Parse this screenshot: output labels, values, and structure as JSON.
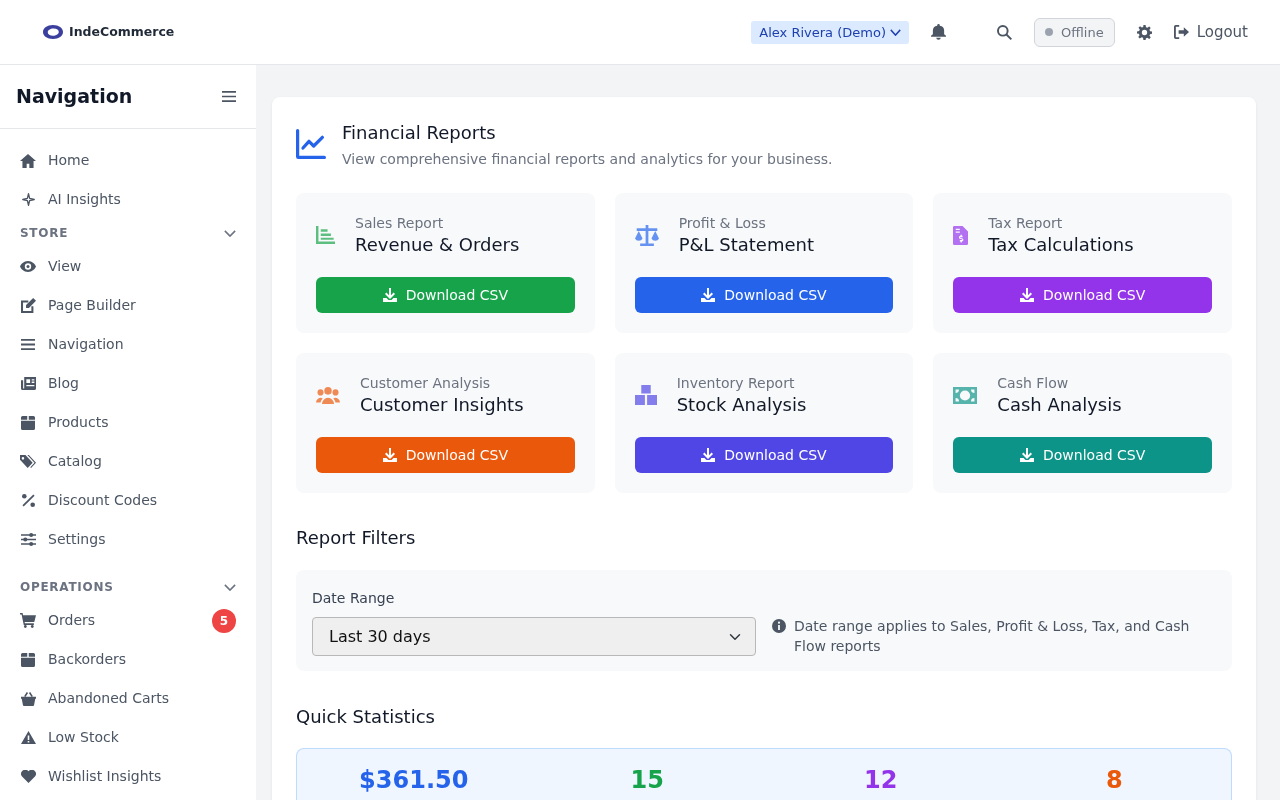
{
  "header": {
    "brand": "IndeCommerce",
    "user_menu": "Alex Rivera (Demo)",
    "status": {
      "label": "Offline",
      "online": false
    },
    "logout": "Logout"
  },
  "sidebar": {
    "title": "Navigation",
    "items": [
      {
        "label": "Home",
        "selected": false
      },
      {
        "label": "AI Insights",
        "selected": false
      }
    ],
    "sections": [
      {
        "heading": "STORE",
        "expanded": true,
        "items": [
          {
            "label": "View",
            "selected": false
          },
          {
            "label": "Page Builder",
            "selected": false
          },
          {
            "label": "Navigation",
            "selected": false
          },
          {
            "label": "Blog",
            "selected": false
          },
          {
            "label": "Products",
            "selected": false
          },
          {
            "label": "Catalog",
            "selected": false
          },
          {
            "label": "Discount Codes",
            "selected": false
          },
          {
            "label": "Settings",
            "selected": false
          }
        ]
      },
      {
        "heading": "OPERATIONS",
        "expanded": true,
        "items": [
          {
            "label": "Orders",
            "selected": false,
            "badge": "5"
          },
          {
            "label": "Backorders",
            "selected": false
          },
          {
            "label": "Abandoned Carts",
            "selected": false
          },
          {
            "label": "Low Stock",
            "selected": false
          },
          {
            "label": "Wishlist Insights",
            "selected": false
          }
        ]
      }
    ]
  },
  "main": {
    "title": "Financial Reports",
    "subtitle": "View comprehensive financial reports and analytics for your business.",
    "reports": [
      {
        "label": "Sales Report",
        "title": "Revenue & Orders",
        "button": "Download CSV",
        "color": "#16a34a"
      },
      {
        "label": "Profit & Loss",
        "title": "P&L Statement",
        "button": "Download CSV",
        "color": "#2563eb"
      },
      {
        "label": "Tax Report",
        "title": "Tax Calculations",
        "button": "Download CSV",
        "color": "#9333ea"
      },
      {
        "label": "Customer Analysis",
        "title": "Customer Insights",
        "button": "Download CSV",
        "color": "#ea580c"
      },
      {
        "label": "Inventory Report",
        "title": "Stock Analysis",
        "button": "Download CSV",
        "color": "#4f46e5"
      },
      {
        "label": "Cash Flow",
        "title": "Cash Analysis",
        "button": "Download CSV",
        "color": "#0d9488"
      }
    ],
    "filters": {
      "heading": "Report Filters",
      "date_range": {
        "label": "Date Range",
        "value": "Last 30 days"
      },
      "note": "Date range applies to Sales, Profit & Loss, Tax, and Cash Flow reports"
    },
    "quick_stats": {
      "heading": "Quick Statistics",
      "stats": [
        {
          "value": "$361.50",
          "color": "#2563eb"
        },
        {
          "value": "15",
          "color": "#16a34a"
        },
        {
          "value": "12",
          "color": "#9333ea"
        },
        {
          "value": "8",
          "color": "#ea580c"
        }
      ]
    }
  }
}
